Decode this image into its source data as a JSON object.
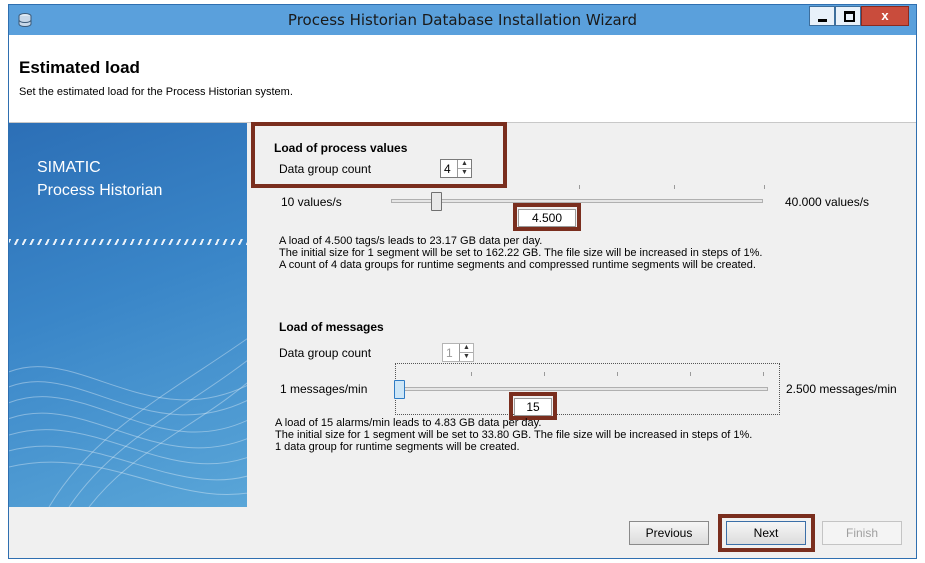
{
  "window": {
    "title": "Process Historian Database Installation Wizard",
    "close_glyph": "x"
  },
  "header": {
    "title": "Estimated load",
    "subtitle": "Set the estimated load for the Process Historian system."
  },
  "sidebar": {
    "brand_line1": "SIMATIC",
    "brand_line2": "Process Historian"
  },
  "process_values": {
    "section_title": "Load of process values",
    "data_group_label": "Data group count",
    "data_group_count": "4",
    "min_label": "10 values/s",
    "max_label": "40.000 values/s",
    "slider_value": "4.500",
    "description_lines": [
      "A load of 4.500 tags/s leads to 23.17 GB data per day.",
      "The initial size for 1 segment will be set to 162.22 GB. The file size will be increased in steps of 1%.",
      "A count of 4 data groups for runtime segments and compressed runtime segments will be created."
    ]
  },
  "messages": {
    "section_title": "Load of messages",
    "data_group_label": "Data group count",
    "data_group_count": "1",
    "min_label": "1 messages/min",
    "max_label": "2.500 messages/min",
    "slider_value": "15",
    "description_lines": [
      "A load of 15 alarms/min leads to 4.83 GB data per day.",
      "The initial size for 1 segment will be set to 33.80 GB. The file size will be increased in steps of 1%.",
      "1 data group for runtime segments will be created."
    ]
  },
  "buttons": {
    "previous": "Previous",
    "next": "Next",
    "finish": "Finish"
  },
  "colors": {
    "titlebar": "#5aa0dc",
    "highlight": "#7a2e1e",
    "sidebar": "#3a86c8"
  }
}
